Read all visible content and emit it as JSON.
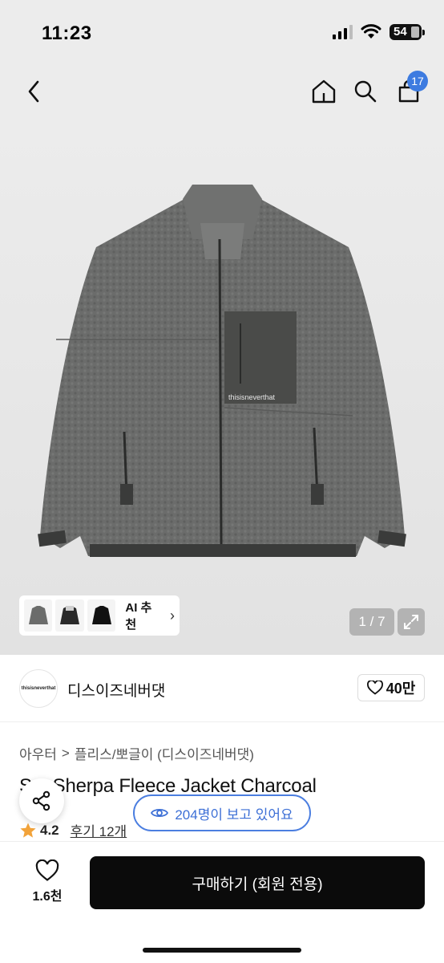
{
  "status": {
    "time": "11:23",
    "battery": "54"
  },
  "nav": {
    "back_icon": "chevron-left-icon",
    "home_icon": "home-icon",
    "search_icon": "search-icon",
    "cart_icon": "shopping-bag-icon",
    "cart_badge": "17"
  },
  "hero": {
    "jacket_logo_text": "thisisneverthat",
    "ai_recommend_label": "AI 추천",
    "ai_chevron": "›",
    "pager": "1 / 7"
  },
  "brand": {
    "logo_text": "thisisneverthat",
    "name": "디스이즈네버댓",
    "like_count": "40만"
  },
  "product": {
    "breadcrumb": [
      "아우터",
      "플리스/뽀글이 (디스이즈네버댓)"
    ],
    "breadcrumb_sep": ">",
    "title": "S... Sherpa Fleece Jacket Charcoal",
    "rating": "4.2",
    "reviews": "후기 12개"
  },
  "overlay": {
    "viewers": "204명이 보고 있어요"
  },
  "bottom": {
    "wish_count": "1.6천",
    "buy_label": "구매하기 (회원 전용)"
  },
  "colors": {
    "accent": "#3d7be0",
    "buy_button": "#0b0b0b",
    "star": "#f2a33a",
    "jacket": "#6b6c6b"
  }
}
